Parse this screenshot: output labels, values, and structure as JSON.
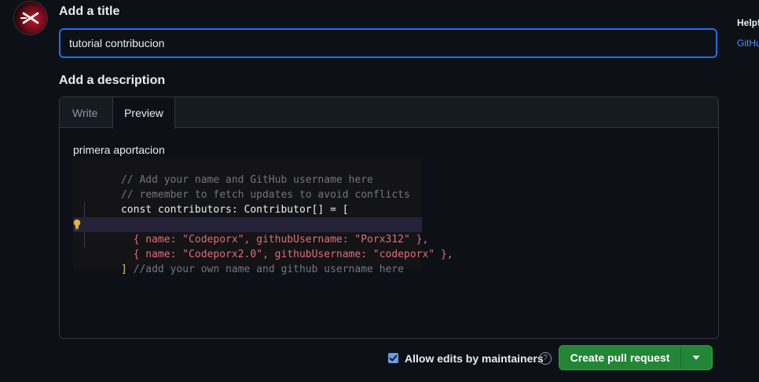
{
  "form": {
    "title_label": "Add a title",
    "title_value": "tutorial contribucion",
    "description_label": "Add a description"
  },
  "editor": {
    "tabs": [
      {
        "label": "Write",
        "active": false
      },
      {
        "label": "Preview",
        "active": true
      }
    ],
    "preview_text": "primera aportacion",
    "code_lines": [
      "// Add your name and GitHub username here",
      "// remember to fetch updates to avoid conflicts",
      "const contributors: Contributor[] = [",
      "  { name: \"Codeporx\", githubUsername: \"Porx312\" },",
      "  { name: \"Codeporx2.0\", githubUsername: \"codeporx\" },",
      "  //add your own name and github username here",
      "]"
    ]
  },
  "sidebar": {
    "help_title": "Helpf",
    "help_link": "GitHu"
  },
  "footer": {
    "allow_edits_label": "Allow edits by maintainers",
    "allow_edits_checked": true,
    "create_pr_label": "Create pull request"
  },
  "icons": {
    "avatar": "avatar-icon",
    "help": "question-circle-icon",
    "dropdown": "triangle-down-icon",
    "lightbulb": "lightbulb-icon",
    "check": "check-icon"
  },
  "colors": {
    "accent": "#1f6feb",
    "primary_button": "#238636",
    "link": "#4493f8",
    "background": "#0d1117"
  }
}
